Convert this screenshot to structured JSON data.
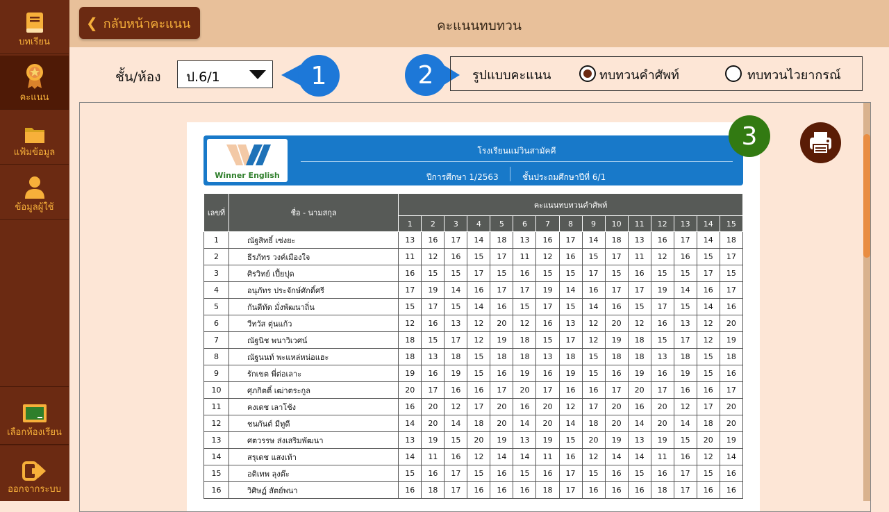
{
  "sidebar": {
    "items": [
      {
        "label": "บทเรียน",
        "icon": "book-icon"
      },
      {
        "label": "คะแนน",
        "icon": "medal-icon"
      },
      {
        "label": "แฟ้มข้อมูล",
        "icon": "folder-icon"
      },
      {
        "label": "ข้อมูลผู้ใช้",
        "icon": "user-icon"
      }
    ],
    "bottom_items": [
      {
        "label": "เลือกห้องเรียน",
        "icon": "chalkboard-icon"
      },
      {
        "label": "ออกจากระบบ",
        "icon": "logout-icon"
      }
    ]
  },
  "header": {
    "back_label": "กลับหน้าคะแนน",
    "title": "คะแนนทบทวน"
  },
  "filters": {
    "class_label": "ชั้น/ห้อง",
    "class_value": "ป.6/1",
    "format_label": "รูปแบบคะแนน",
    "options": [
      "ทบทวนคำศัพท์",
      "ทบทวนไวยากรณ์"
    ],
    "selected": "ทบทวนคำศัพท์"
  },
  "callouts": [
    "1",
    "2",
    "3"
  ],
  "report": {
    "logo_text": "Winner English",
    "school": "โรงเรียนแม่วินสามัคคี",
    "year": "ปีการศึกษา 1/2563",
    "grade": "ชั้นประถมศึกษาปีที่ 6/1",
    "col_no": "เลขที่",
    "col_name": "ชื่อ - นามสกุล",
    "col_scores": "คะแนนทบทวนคำศัพท์",
    "score_cols": [
      "1",
      "2",
      "3",
      "4",
      "5",
      "6",
      "7",
      "8",
      "9",
      "10",
      "11",
      "12",
      "13",
      "14",
      "15"
    ],
    "rows": [
      {
        "no": "1",
        "name": "ณัฐสิทธิ์ เซ่งยะ",
        "scores": [
          "13",
          "16",
          "17",
          "14",
          "18",
          "13",
          "16",
          "17",
          "14",
          "18",
          "13",
          "16",
          "17",
          "14",
          "18"
        ]
      },
      {
        "no": "2",
        "name": "ธีรภัทร วงค์เมืองใจ",
        "scores": [
          "11",
          "12",
          "16",
          "15",
          "17",
          "11",
          "12",
          "16",
          "15",
          "17",
          "11",
          "12",
          "16",
          "15",
          "17"
        ]
      },
      {
        "no": "3",
        "name": "ศิรวิทย์ เปี้ยปุด",
        "scores": [
          "16",
          "15",
          "15",
          "17",
          "15",
          "16",
          "15",
          "15",
          "17",
          "15",
          "16",
          "15",
          "15",
          "17",
          "15"
        ]
      },
      {
        "no": "4",
        "name": "อนุภัทร ประจักษ์ศักดิ์ศรี",
        "scores": [
          "17",
          "19",
          "14",
          "16",
          "17",
          "17",
          "19",
          "14",
          "16",
          "17",
          "17",
          "19",
          "14",
          "16",
          "17"
        ]
      },
      {
        "no": "5",
        "name": "กันตีทัต มั่งพัฒนาถิ่น",
        "scores": [
          "15",
          "17",
          "15",
          "14",
          "16",
          "15",
          "17",
          "15",
          "14",
          "16",
          "15",
          "17",
          "15",
          "14",
          "16"
        ]
      },
      {
        "no": "6",
        "name": "วีทวัส ตุ่นแก้ว",
        "scores": [
          "12",
          "16",
          "13",
          "12",
          "20",
          "12",
          "16",
          "13",
          "12",
          "20",
          "12",
          "16",
          "13",
          "12",
          "20"
        ]
      },
      {
        "no": "7",
        "name": "ณัฐนิช พนาวิเวศน์",
        "scores": [
          "18",
          "15",
          "17",
          "12",
          "19",
          "18",
          "15",
          "17",
          "12",
          "19",
          "18",
          "15",
          "17",
          "12",
          "19"
        ]
      },
      {
        "no": "8",
        "name": "ณัฐนนท์ พะแหล่หน่อแฮะ",
        "scores": [
          "18",
          "13",
          "18",
          "15",
          "18",
          "18",
          "13",
          "18",
          "15",
          "18",
          "18",
          "13",
          "18",
          "15",
          "18"
        ]
      },
      {
        "no": "9",
        "name": "รักเขต พี่ต่อเลาะ",
        "scores": [
          "19",
          "16",
          "19",
          "15",
          "16",
          "19",
          "16",
          "19",
          "15",
          "16",
          "19",
          "16",
          "19",
          "15",
          "16"
        ]
      },
      {
        "no": "10",
        "name": "ศุภกิตติ์ เฒ่าตระกูล",
        "scores": [
          "20",
          "17",
          "16",
          "16",
          "17",
          "20",
          "17",
          "16",
          "16",
          "17",
          "20",
          "17",
          "16",
          "16",
          "17"
        ]
      },
      {
        "no": "11",
        "name": "คงเดช เลาโช้ง",
        "scores": [
          "16",
          "20",
          "12",
          "17",
          "20",
          "16",
          "20",
          "12",
          "17",
          "20",
          "16",
          "20",
          "12",
          "17",
          "20"
        ]
      },
      {
        "no": "12",
        "name": "ชนกันต์ มีทูดี",
        "scores": [
          "14",
          "20",
          "14",
          "18",
          "20",
          "14",
          "20",
          "14",
          "18",
          "20",
          "14",
          "20",
          "14",
          "18",
          "20"
        ]
      },
      {
        "no": "13",
        "name": "ศตวรรษ ส่งเสริมพัฒนา",
        "scores": [
          "13",
          "19",
          "15",
          "20",
          "19",
          "13",
          "19",
          "15",
          "20",
          "19",
          "13",
          "19",
          "15",
          "20",
          "19"
        ]
      },
      {
        "no": "14",
        "name": "สรุเดช แสงเท้า",
        "scores": [
          "14",
          "11",
          "16",
          "12",
          "14",
          "14",
          "11",
          "16",
          "12",
          "14",
          "14",
          "11",
          "16",
          "12",
          "14"
        ]
      },
      {
        "no": "15",
        "name": "อติเทพ ลุงต๊ะ",
        "scores": [
          "15",
          "16",
          "17",
          "15",
          "16",
          "15",
          "16",
          "17",
          "15",
          "16",
          "15",
          "16",
          "17",
          "15",
          "16"
        ]
      },
      {
        "no": "16",
        "name": "วิศิษฏ์ สัตย์พนา",
        "scores": [
          "16",
          "18",
          "17",
          "16",
          "16",
          "16",
          "18",
          "17",
          "16",
          "16",
          "16",
          "18",
          "17",
          "16",
          "16"
        ]
      }
    ]
  },
  "colors": {
    "sidebar": "#6b2a12",
    "accent": "#f7b03a",
    "callout_blue": "#1d78d8",
    "callout_green": "#327a12",
    "report_header": "#1879c9"
  }
}
